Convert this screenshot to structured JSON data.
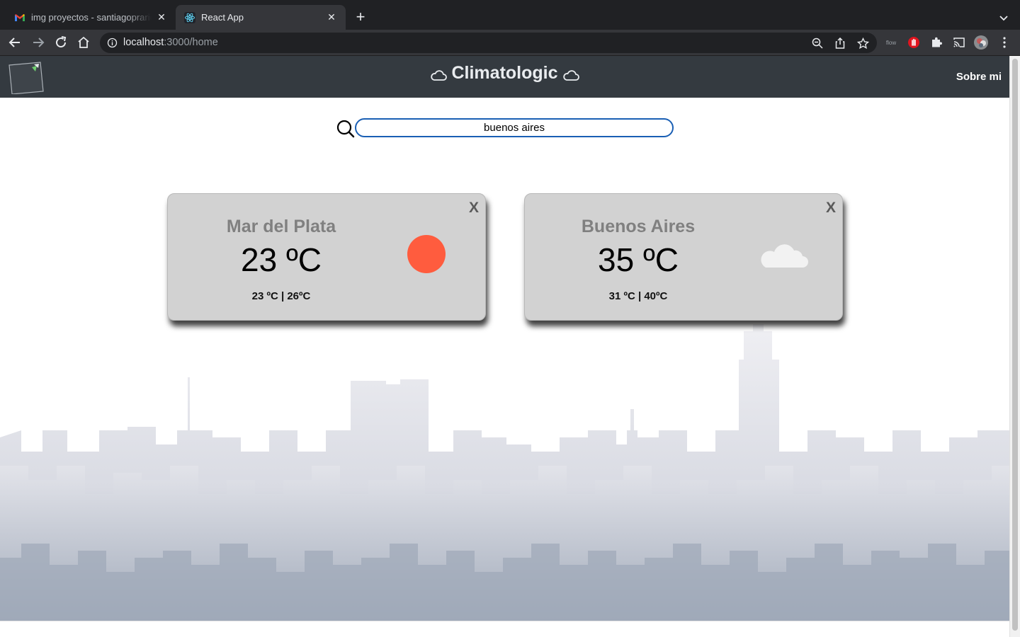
{
  "browser": {
    "tabs": [
      {
        "title": "img proyectos - santiagoprario",
        "icon": "gmail-icon",
        "active": false
      },
      {
        "title": "React App",
        "icon": "react-icon",
        "active": true
      }
    ],
    "url_host": "localhost",
    "url_path": ":3000/home",
    "extension_label": "flow"
  },
  "navbar": {
    "brand": "Climatologic",
    "about_link": "Sobre mi"
  },
  "search": {
    "value": "buenos aires",
    "placeholder": ""
  },
  "cards": [
    {
      "city": "Mar del Plata",
      "temp": "23 ºC",
      "range": "23 ºC | 26ºC",
      "close": "X",
      "icon": "sun-icon",
      "icon_color": "#ff5c3e"
    },
    {
      "city": "Buenos Aires",
      "temp": "35 ºC",
      "range": "31 ºC | 40ºC",
      "close": "X",
      "icon": "cloud-icon",
      "icon_color": "#f2f2f2"
    }
  ],
  "colors": {
    "navbar_bg": "#343a40",
    "card_bg": "#d2d2d2",
    "search_border": "#1a5fb4"
  }
}
